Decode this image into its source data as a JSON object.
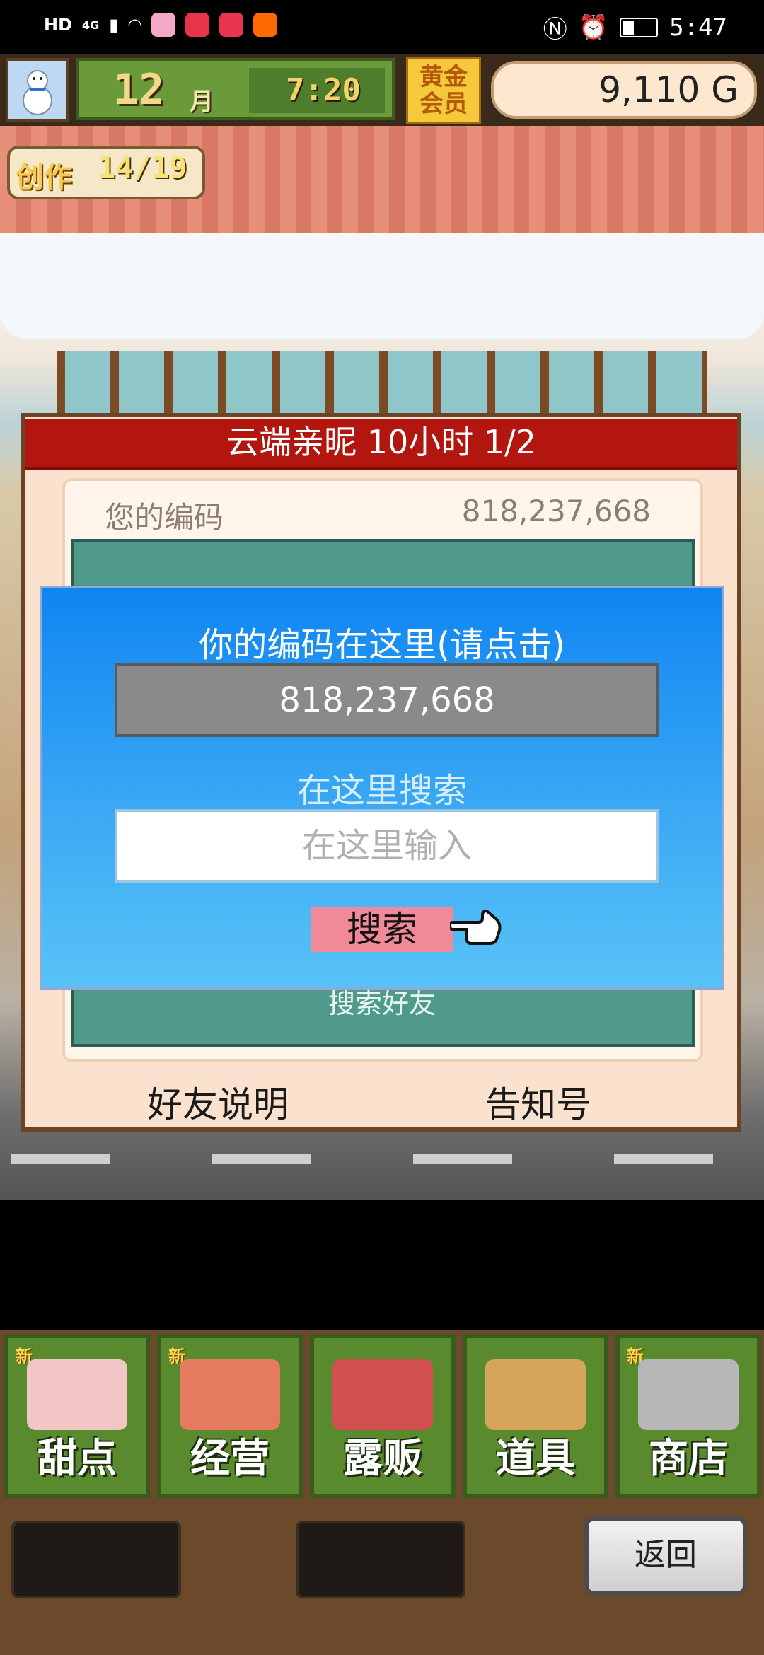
{
  "status_bar": {
    "left_text": "HD",
    "network": "4G",
    "time": "5:47"
  },
  "hud": {
    "month_number": "12",
    "month_unit": "月",
    "time": "7:20",
    "member_badge": "黄金会员",
    "money": "9,110 G"
  },
  "craft": {
    "label": "创作",
    "count": "14/19"
  },
  "friend_panel": {
    "title": "云端亲昵  10小时 1/2",
    "code_label": "您的编码",
    "code_value": "818,237,668",
    "search_friend_button": "搜索好友",
    "friend_help_link": "好友说明",
    "notice_link": "告知号"
  },
  "dialog": {
    "title": "你的编码在这里(请点击)",
    "code": "818,237,668",
    "search_label": "在这里搜索",
    "search_placeholder": "在这里输入",
    "search_button": "搜索"
  },
  "bottom_nav": {
    "new_badge": "新",
    "items": [
      {
        "label": "甜点",
        "icon": "cake-icon",
        "has_new": true,
        "color": "#f3c6c6"
      },
      {
        "label": "经营",
        "icon": "shop-icon",
        "has_new": true,
        "color": "#e57a5f"
      },
      {
        "label": "露贩",
        "icon": "food-truck-icon",
        "has_new": false,
        "color": "#d24f4f"
      },
      {
        "label": "道具",
        "icon": "item-bag-icon",
        "has_new": false,
        "color": "#d6a45b"
      },
      {
        "label": "商店",
        "icon": "shopping-cart-icon",
        "has_new": true,
        "color": "#b7b7b7"
      }
    ],
    "back_button": "返回"
  },
  "colors": {
    "panel_title_red": "#b3160e",
    "dialog_blue": "#1f95f3",
    "search_button_pink": "#f08a98",
    "nav_green": "#5a8a2e"
  }
}
